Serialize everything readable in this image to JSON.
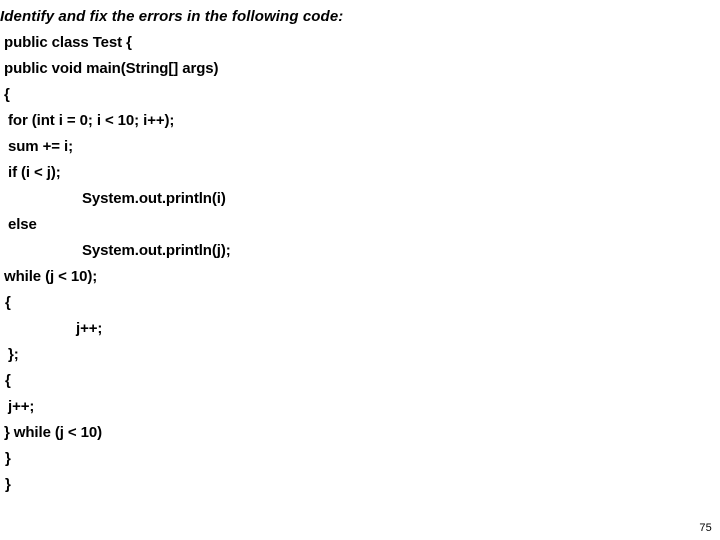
{
  "slide": {
    "background_color": "#ffffff",
    "text_color": "#000000",
    "page_number": "75"
  },
  "prompt": {
    "text": "Identify and fix the errors in the following code:"
  },
  "code": {
    "lines": [
      {
        "text": "public class Test {",
        "indent": "ind-1"
      },
      {
        "text": "public void main(String[] args)",
        "indent": "ind-1"
      },
      {
        "text": "{",
        "indent": "ind-1"
      },
      {
        "text": "for (int i = 0; i < 10; i++);",
        "indent": "ind-2"
      },
      {
        "text": "sum += i;",
        "indent": "ind-2"
      },
      {
        "text": "if (i < j);",
        "indent": "ind-2"
      },
      {
        "text": "System.out.println(i)",
        "indent": "ind-deep"
      },
      {
        "text": "else",
        "indent": "ind-2"
      },
      {
        "text": "System.out.println(j);",
        "indent": "ind-deep"
      },
      {
        "text": "while (j < 10);",
        "indent": "ind-1"
      },
      {
        "text": "{",
        "indent": "ind-3"
      },
      {
        "text": "j++;",
        "indent": "ind-deep2"
      },
      {
        "text": "};",
        "indent": "ind-2"
      },
      {
        "text": "{",
        "indent": "ind-3"
      },
      {
        "text": "j++;",
        "indent": "ind-2"
      },
      {
        "text": "} while (j < 10)",
        "indent": "ind-1"
      },
      {
        "text": "}",
        "indent": "ind-3"
      },
      {
        "text": "}",
        "indent": "ind-3"
      }
    ]
  }
}
